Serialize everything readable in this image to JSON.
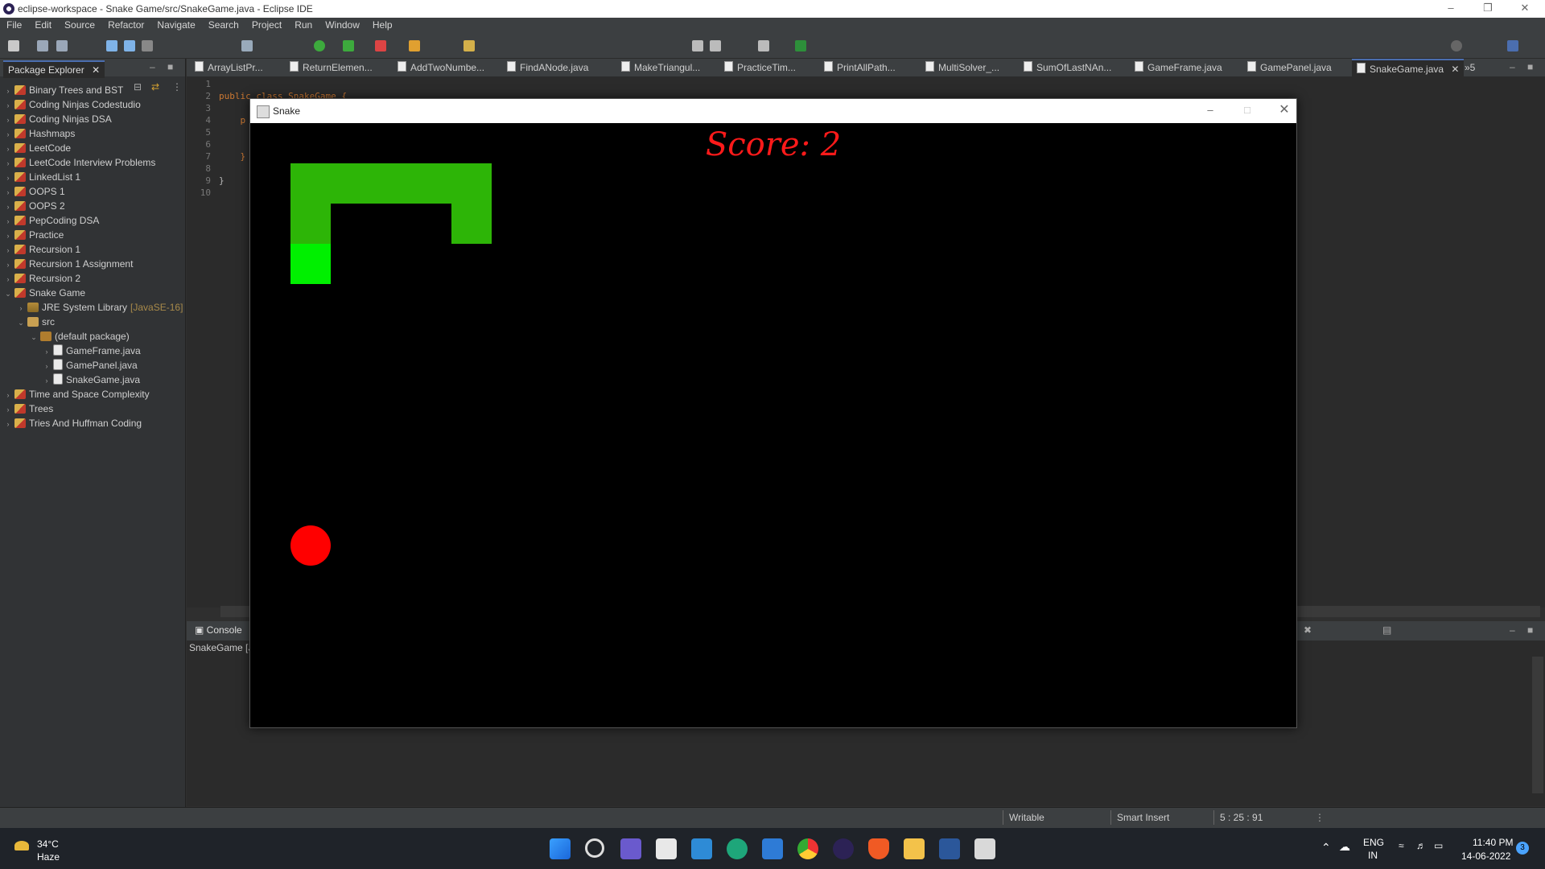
{
  "window_title": "eclipse-workspace - Snake Game/src/SnakeGame.java - Eclipse IDE",
  "menu": [
    "File",
    "Edit",
    "Source",
    "Refactor",
    "Navigate",
    "Search",
    "Project",
    "Run",
    "Window",
    "Help"
  ],
  "package_explorer": {
    "title": "Package Explorer",
    "items": [
      {
        "label": "Binary Trees and BST",
        "icon": "project-icon",
        "arrow": "›"
      },
      {
        "label": "Coding Ninjas Codestudio",
        "icon": "project-icon",
        "arrow": "›"
      },
      {
        "label": "Coding Ninjas DSA",
        "icon": "project-icon",
        "arrow": "›"
      },
      {
        "label": "Hashmaps",
        "icon": "project-icon",
        "arrow": "›"
      },
      {
        "label": "LeetCode",
        "icon": "project-icon",
        "arrow": "›"
      },
      {
        "label": "LeetCode Interview Problems",
        "icon": "project-icon",
        "arrow": "›"
      },
      {
        "label": "LinkedList 1",
        "icon": "project-icon",
        "arrow": "›"
      },
      {
        "label": "OOPS 1",
        "icon": "project-icon",
        "arrow": "›"
      },
      {
        "label": "OOPS 2",
        "icon": "project-icon",
        "arrow": "›"
      },
      {
        "label": "PepCoding DSA",
        "icon": "project-icon",
        "arrow": "›"
      },
      {
        "label": "Practice",
        "icon": "project-icon",
        "arrow": "›"
      },
      {
        "label": "Recursion 1",
        "icon": "project-icon",
        "arrow": "›"
      },
      {
        "label": "Recursion 1 Assignment",
        "icon": "project-icon",
        "arrow": "›"
      },
      {
        "label": "Recursion 2",
        "icon": "project-icon",
        "arrow": "›"
      },
      {
        "label": "Snake Game",
        "icon": "project-icon",
        "arrow": "⌄"
      }
    ],
    "snake_children": {
      "jre": "JRE System Library",
      "jre_version": "[JavaSE-16]",
      "src": "src",
      "default_package": "(default package)",
      "files": [
        "GameFrame.java",
        "GamePanel.java",
        "SnakeGame.java"
      ]
    },
    "items_after": [
      {
        "label": "Time and Space Complexity",
        "icon": "project-icon",
        "arrow": "›"
      },
      {
        "label": "Trees",
        "icon": "project-icon",
        "arrow": "›"
      },
      {
        "label": "Tries And Huffman Coding",
        "icon": "project-icon",
        "arrow": "›"
      }
    ]
  },
  "editor_tabs": [
    "ArrayListPr...",
    "ReturnElemen...",
    "AddTwoNumbe...",
    "FindANode.java",
    "MakeTriangul...",
    "PracticeTim...",
    "PrintAllPath...",
    "MultiSolver_...",
    "SumOfLastNAn...",
    "GameFrame.java",
    "GamePanel.java",
    "SnakeGame.java"
  ],
  "active_tab": "SnakeGame.java",
  "overflow_tab": "»5",
  "line_numbers": [
    "1",
    "2",
    "3",
    "4",
    "5",
    "6",
    "7",
    "8",
    "9",
    "10"
  ],
  "code_lines": {
    "l2": "public class SnakeGame {",
    "l4": "    p",
    "l7": "    }",
    "l9": "}"
  },
  "console": {
    "tab": "Console",
    "launch": "SnakeGame [J"
  },
  "status": {
    "writable": "Writable",
    "insert_mode": "Smart Insert",
    "position": "5 : 25 : 91"
  },
  "snake_window": {
    "title": "Snake",
    "score_label": "Score: 2",
    "board": {
      "cols": 26,
      "rows": 15,
      "cell_units": 1
    },
    "snake_cells": [
      [
        5,
        2
      ],
      [
        5,
        1
      ],
      [
        4,
        1
      ],
      [
        3,
        1
      ],
      [
        2,
        1
      ],
      [
        1,
        1
      ],
      [
        1,
        2
      ],
      [
        1,
        3
      ]
    ],
    "head_cell": [
      1,
      3
    ],
    "apple_cell": [
      1,
      10
    ],
    "colors": {
      "body": "#2db507",
      "head": "#00f000",
      "apple": "#ff0000",
      "background": "#000000",
      "score": "#ff1a1a"
    }
  },
  "taskbar": {
    "weather_temp": "34°C",
    "weather_desc": "Haze",
    "lang_top": "ENG",
    "lang_bottom": "IN",
    "time": "11:40 PM",
    "date": "14-06-2022",
    "notification_count": "3"
  }
}
